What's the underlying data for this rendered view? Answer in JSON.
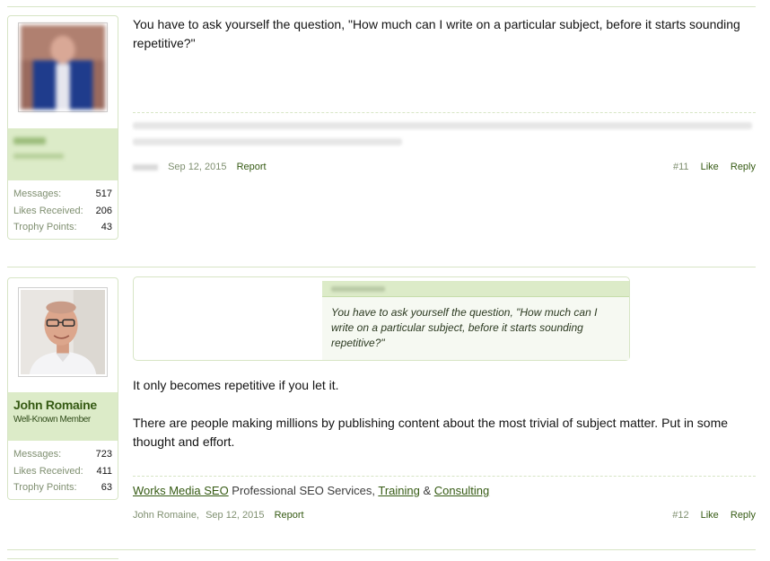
{
  "post11": {
    "message": "You have to ask yourself the question, \"How much can I write on a particular subject, before it starts sounding repetitive?\"",
    "date": "Sep 12, 2015",
    "report": "Report",
    "number": "#11",
    "like": "Like",
    "reply": "Reply",
    "stats": {
      "messages_label": "Messages:",
      "messages": "517",
      "likes_label": "Likes Received:",
      "likes": "206",
      "trophy_label": "Trophy Points:",
      "trophy": "43"
    }
  },
  "post12": {
    "username": "John Romaine",
    "user_title": "Well-Known Member",
    "quote": "You have to ask yourself the question, \"How much can I write on a particular subject, before it starts sounding repetitive?\"",
    "message_p1": "It only becomes repetitive if you let it.",
    "message_p2": "There are people making millions by publishing content about the most trivial of subject matter. Put in some thought and effort.",
    "signature": {
      "link1": "Works Media SEO",
      "text1": " Professional SEO Services, ",
      "link2": "Training",
      "text2": " & ",
      "link3": "Consulting"
    },
    "author": "John Romaine,",
    "date": "Sep 12, 2015",
    "report": "Report",
    "number": "#12",
    "like": "Like",
    "reply": "Reply",
    "stats": {
      "messages_label": "Messages:",
      "messages": "723",
      "likes_label": "Likes Received:",
      "likes": "411",
      "trophy_label": "Trophy Points:",
      "trophy": "63"
    }
  },
  "colors": {
    "accent_green": "#355a13",
    "light_green": "#dcebc8",
    "border_green": "#d7e5c5"
  }
}
